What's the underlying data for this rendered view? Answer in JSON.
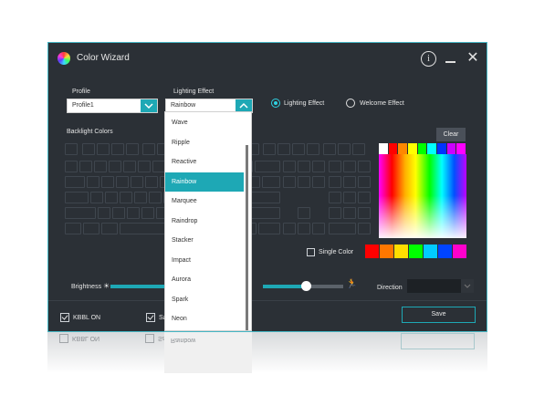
{
  "window": {
    "title": "Color Wizard"
  },
  "titlebar": {
    "info_glyph": "i",
    "close_glyph": "✕"
  },
  "profile": {
    "label": "Profile",
    "value": "Profile1"
  },
  "lighting": {
    "label": "Lighting Effect",
    "value": "Rainbow",
    "options": [
      "Wave",
      "Ripple",
      "Reactive",
      "Rainbow",
      "Marquee",
      "Raindrop",
      "Stacker",
      "Impact",
      "Aurora",
      "Spark",
      "Neon"
    ],
    "selected_index": 3,
    "reflected_option": "Rainbow"
  },
  "mode": {
    "lighting_effect": "Lighting Effect",
    "welcome_effect": "Welcome Effect",
    "selected": "lighting_effect"
  },
  "backlight": {
    "label": "Backlight Colors",
    "clear_label": "Clear"
  },
  "color_picker": {
    "top_swatches": [
      "#ffffff",
      "#ff0000",
      "#ff8800",
      "#ffff00",
      "#00ff00",
      "#00ffff",
      "#0033ff",
      "#cc00ff",
      "#ff00ff"
    ],
    "bottom_swatches": [
      "#ff0000",
      "#ff7700",
      "#ffdd00",
      "#00ff00",
      "#00ccff",
      "#0044ff",
      "#ff00cc"
    ],
    "single_color_label": "Single Color",
    "single_color_checked": false
  },
  "brightness": {
    "label": "Brightness",
    "level": 0.55
  },
  "speed": {
    "level": 0.75
  },
  "direction": {
    "label": "Direction",
    "value": ""
  },
  "footer": {
    "kbbl_label": "KBBL ON",
    "kbbl_checked": true,
    "save_check_label": "Sav",
    "save_checked": true,
    "save_button": "Save"
  },
  "colors": {
    "accent": "#1ea8b5",
    "window_bg": "#2b3036",
    "border": "#45b6c4"
  }
}
